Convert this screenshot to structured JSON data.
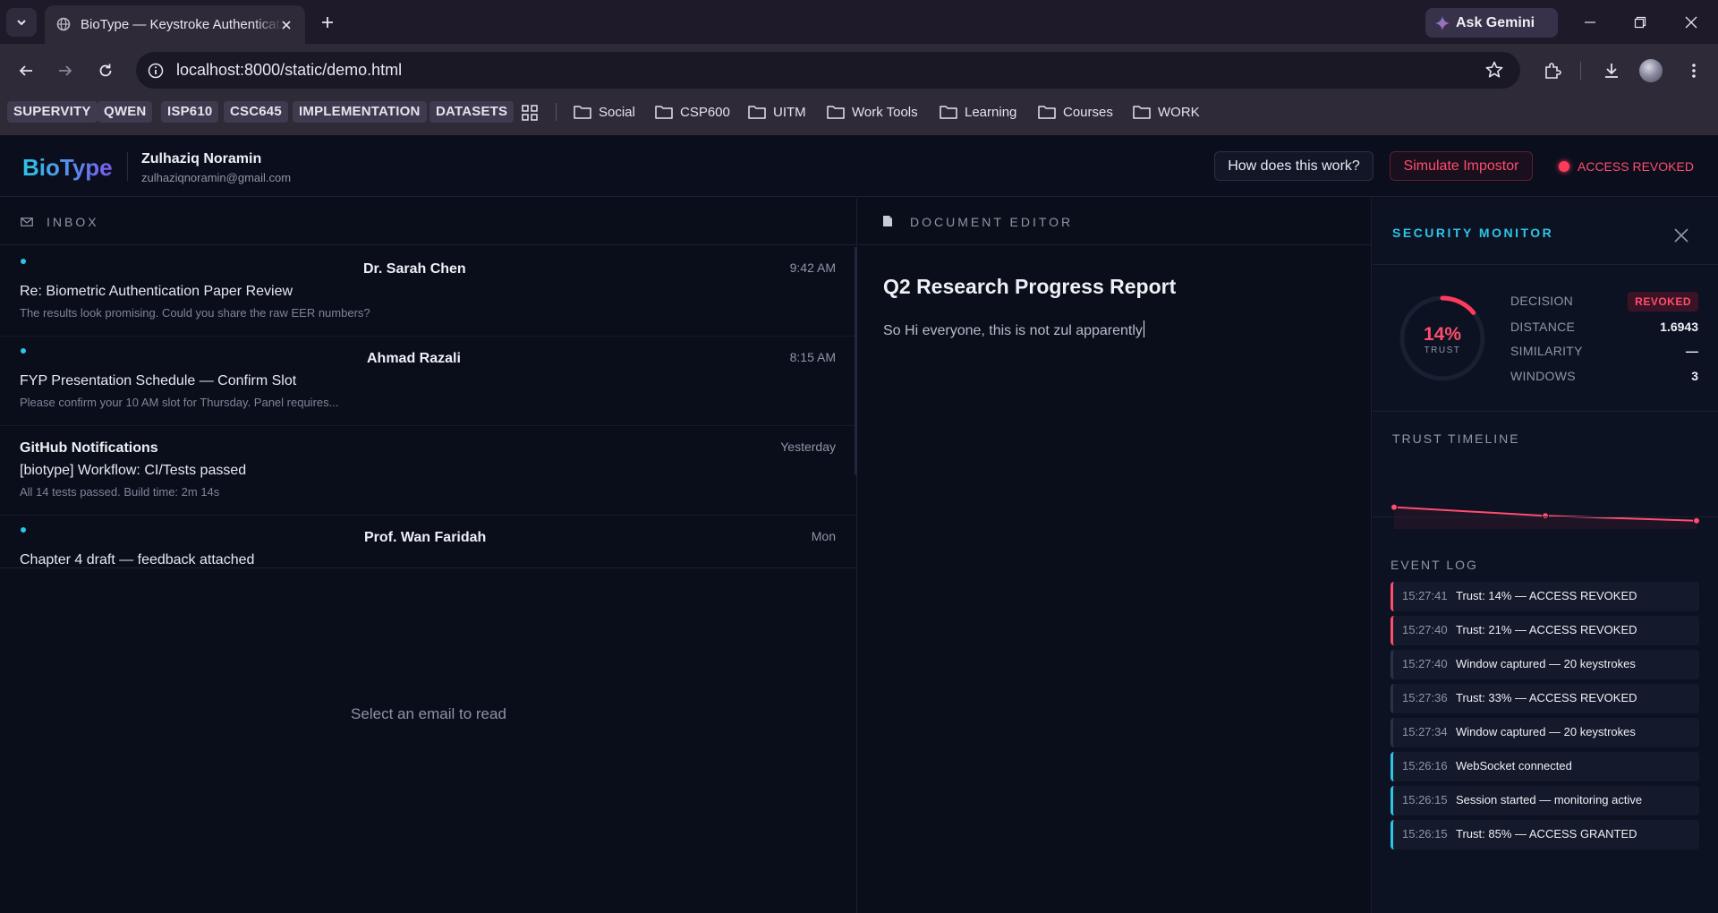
{
  "browser": {
    "tab_title": "BioType — Keystroke Authentication",
    "ask_gemini_label": "Ask Gemini",
    "url": "localhost:8000/static/demo.html",
    "bookmarks": {
      "chips": [
        "SUPERVITY",
        "QWEN",
        "ISP610",
        "CSC645",
        "IMPLEMENTATION",
        "DATASETS"
      ],
      "folders": [
        "Social",
        "CSP600",
        "UITM",
        "Work Tools",
        "Learning",
        "Courses",
        "WORK"
      ]
    }
  },
  "app": {
    "logo": "BioType",
    "user": {
      "name": "Zulhaziq Noramin",
      "email": "zulhaziqnoramin@gmail.com"
    },
    "how_button": "How does this work?",
    "impostor_button": "Simulate Impostor",
    "access_status": "ACCESS REVOKED",
    "status_color": "#ff4d6d",
    "accent_color": "#2ec4e6"
  },
  "inbox": {
    "title": "INBOX",
    "emails": [
      {
        "sender": "Dr. Sarah Chen",
        "time": "9:42 AM",
        "subject": "Re: Biometric Authentication Paper Review",
        "preview": "The results look promising. Could you share the raw EER numbers?",
        "unread": true
      },
      {
        "sender": "Ahmad Razali",
        "time": "8:15 AM",
        "subject": "FYP Presentation Schedule — Confirm Slot",
        "preview": "Please confirm your 10 AM slot for Thursday. Panel requires...",
        "unread": true
      },
      {
        "sender": "GitHub Notifications",
        "time": "Yesterday",
        "subject": "[biotype] Workflow: CI/Tests passed",
        "preview": "All 14 tests passed. Build time: 2m 14s",
        "unread": false
      },
      {
        "sender": "Prof. Wan Faridah",
        "time": "Mon",
        "subject": "Chapter 4 draft — feedback attached",
        "preview": "",
        "unread": true
      }
    ],
    "empty_state": "Select an email to read"
  },
  "editor": {
    "title": "DOCUMENT EDITOR",
    "doc_title": "Q2 Research Progress Report",
    "doc_body": "So Hi everyone, this is not zul apparently"
  },
  "security": {
    "title": "SECURITY MONITOR",
    "trust_percent": "14%",
    "trust_value": 0.14,
    "trust_label": "TRUST",
    "metrics": {
      "decision_label": "DECISION",
      "decision_value": "REVOKED",
      "distance_label": "DISTANCE",
      "distance_value": "1.6943",
      "similarity_label": "SIMILARITY",
      "similarity_value": "—",
      "windows_label": "WINDOWS",
      "windows_value": "3"
    },
    "timeline_title": "TRUST TIMELINE",
    "event_log_title": "EVENT LOG",
    "events": [
      {
        "time": "15:27:41",
        "message": "Trust: 14% — ACCESS REVOKED",
        "level": "danger"
      },
      {
        "time": "15:27:40",
        "message": "Trust: 21% — ACCESS REVOKED",
        "level": "danger"
      },
      {
        "time": "15:27:40",
        "message": "Window captured — 20 keystrokes",
        "level": "neutral"
      },
      {
        "time": "15:27:36",
        "message": "Trust: 33% — ACCESS REVOKED",
        "level": "neutral"
      },
      {
        "time": "15:27:34",
        "message": "Window captured — 20 keystrokes",
        "level": "neutral"
      },
      {
        "time": "15:26:16",
        "message": "WebSocket connected",
        "level": "info"
      },
      {
        "time": "15:26:15",
        "message": "Session started — monitoring active",
        "level": "info"
      },
      {
        "time": "15:26:15",
        "message": "Trust: 85% — ACCESS GRANTED",
        "level": "info"
      }
    ]
  },
  "chart_data": {
    "type": "line",
    "title": "TRUST TIMELINE",
    "xlabel": "",
    "ylabel": "",
    "y": [
      33,
      21,
      14
    ],
    "ylim": [
      0,
      100
    ]
  }
}
